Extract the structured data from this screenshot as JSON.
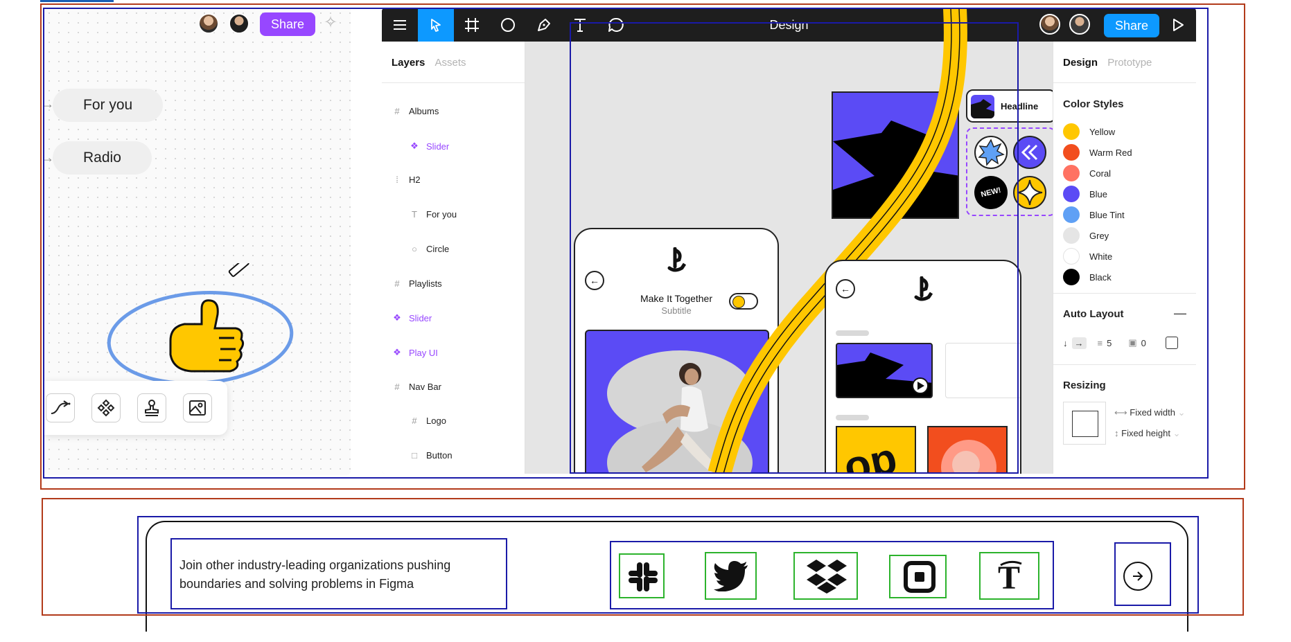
{
  "whiteboard": {
    "share_label": "Share",
    "chips": [
      "For you",
      "Radio"
    ],
    "tools": [
      "connector-icon",
      "component-icon",
      "stamp-icon",
      "image-icon"
    ]
  },
  "editor": {
    "title": "Design",
    "share_label": "Share",
    "toolbar": [
      "menu-icon",
      "move-icon",
      "frame-icon",
      "ellipse-icon",
      "pen-icon",
      "text-icon",
      "comment-icon"
    ],
    "left_tabs": {
      "active": "Layers",
      "inactive": "Assets"
    },
    "layers": [
      {
        "label": "Albums",
        "icon": "#",
        "purple": false,
        "indent": 0
      },
      {
        "label": "Slider",
        "icon": "❖",
        "purple": true,
        "indent": 1
      },
      {
        "label": "H2",
        "icon": "⁞",
        "purple": false,
        "indent": 0
      },
      {
        "label": "For you",
        "icon": "T",
        "purple": false,
        "indent": 1
      },
      {
        "label": "Circle",
        "icon": "○",
        "purple": false,
        "indent": 1
      },
      {
        "label": "Playlists",
        "icon": "#",
        "purple": false,
        "indent": 0
      },
      {
        "label": "Slider",
        "icon": "❖",
        "purple": true,
        "indent": 0
      },
      {
        "label": "Play UI",
        "icon": "❖",
        "purple": true,
        "indent": 0
      },
      {
        "label": "Nav Bar",
        "icon": "#",
        "purple": false,
        "indent": 0
      },
      {
        "label": "Logo",
        "icon": "#",
        "purple": false,
        "indent": 1
      },
      {
        "label": "Button",
        "icon": "□",
        "purple": false,
        "indent": 1
      }
    ],
    "right_tabs": {
      "active": "Design",
      "inactive": "Prototype"
    },
    "color_styles_title": "Color Styles",
    "color_styles": [
      {
        "name": "Yellow",
        "hex": "#ffc700"
      },
      {
        "name": "Warm Red",
        "hex": "#f24e1e"
      },
      {
        "name": "Coral",
        "hex": "#ff7262"
      },
      {
        "name": "Blue",
        "hex": "#5b4bf5"
      },
      {
        "name": "Blue Tint",
        "hex": "#5fa0f5"
      },
      {
        "name": "Grey",
        "hex": "#e5e5e5"
      },
      {
        "name": "White",
        "hex": "#ffffff"
      },
      {
        "name": "Black",
        "hex": "#000000"
      }
    ],
    "auto_layout_title": "Auto Layout",
    "auto_layout_spacing": "5",
    "auto_layout_padding": "0",
    "resizing_title": "Resizing",
    "fixed_width": "Fixed width",
    "fixed_height": "Fixed height",
    "canvas": {
      "headline_label": "Headline",
      "badge_text": "NEW!",
      "phone_title": "Make It Together",
      "phone_subtitle": "Subtitle"
    }
  },
  "banner": {
    "text": "Join other industry-leading organizations pushing boundaries and solving problems in Figma",
    "logos": [
      "slack-logo",
      "twitter-logo",
      "dropbox-logo",
      "square-logo",
      "nytimes-logo"
    ]
  }
}
